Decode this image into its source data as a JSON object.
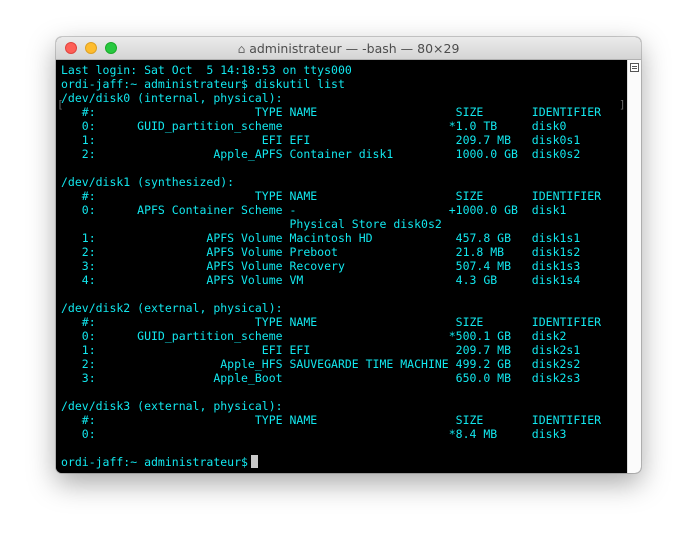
{
  "window": {
    "title": "administrateur — -bash — 80×29",
    "title_icon": "home-folder-icon"
  },
  "terminal": {
    "lines": [
      "Last login: Sat Oct  5 14:18:53 on ttys000",
      "ordi-jaff:~ administrateur$ diskutil list",
      "/dev/disk0 (internal, physical):",
      "   #:                       TYPE NAME                    SIZE       IDENTIFIER",
      "   0:      GUID_partition_scheme                        *1.0 TB     disk0",
      "   1:                        EFI EFI                     209.7 MB   disk0s1",
      "   2:                 Apple_APFS Container disk1         1000.0 GB  disk0s2",
      "",
      "/dev/disk1 (synthesized):",
      "   #:                       TYPE NAME                    SIZE       IDENTIFIER",
      "   0:      APFS Container Scheme -                      +1000.0 GB  disk1",
      "                                 Physical Store disk0s2",
      "   1:                APFS Volume Macintosh HD            457.8 GB   disk1s1",
      "   2:                APFS Volume Preboot                 21.8 MB    disk1s2",
      "   3:                APFS Volume Recovery                507.4 MB   disk1s3",
      "   4:                APFS Volume VM                      4.3 GB     disk1s4",
      "",
      "/dev/disk2 (external, physical):",
      "   #:                       TYPE NAME                    SIZE       IDENTIFIER",
      "   0:      GUID_partition_scheme                        *500.1 GB   disk2",
      "   1:                        EFI EFI                     209.7 MB   disk2s1",
      "   2:                  Apple_HFS SAUVEGARDE TIME MACHINE 499.2 GB   disk2s2",
      "   3:                 Apple_Boot                         650.0 MB   disk2s3",
      "",
      "/dev/disk3 (external, physical):",
      "   #:                       TYPE NAME                    SIZE       IDENTIFIER",
      "   0:                                                   *8.4 MB     disk3",
      "",
      "ordi-jaff:~ administrateur$"
    ],
    "colors": {
      "text": "#12e7ee",
      "background": "#000000",
      "cursor": "#c8c8c8"
    }
  }
}
